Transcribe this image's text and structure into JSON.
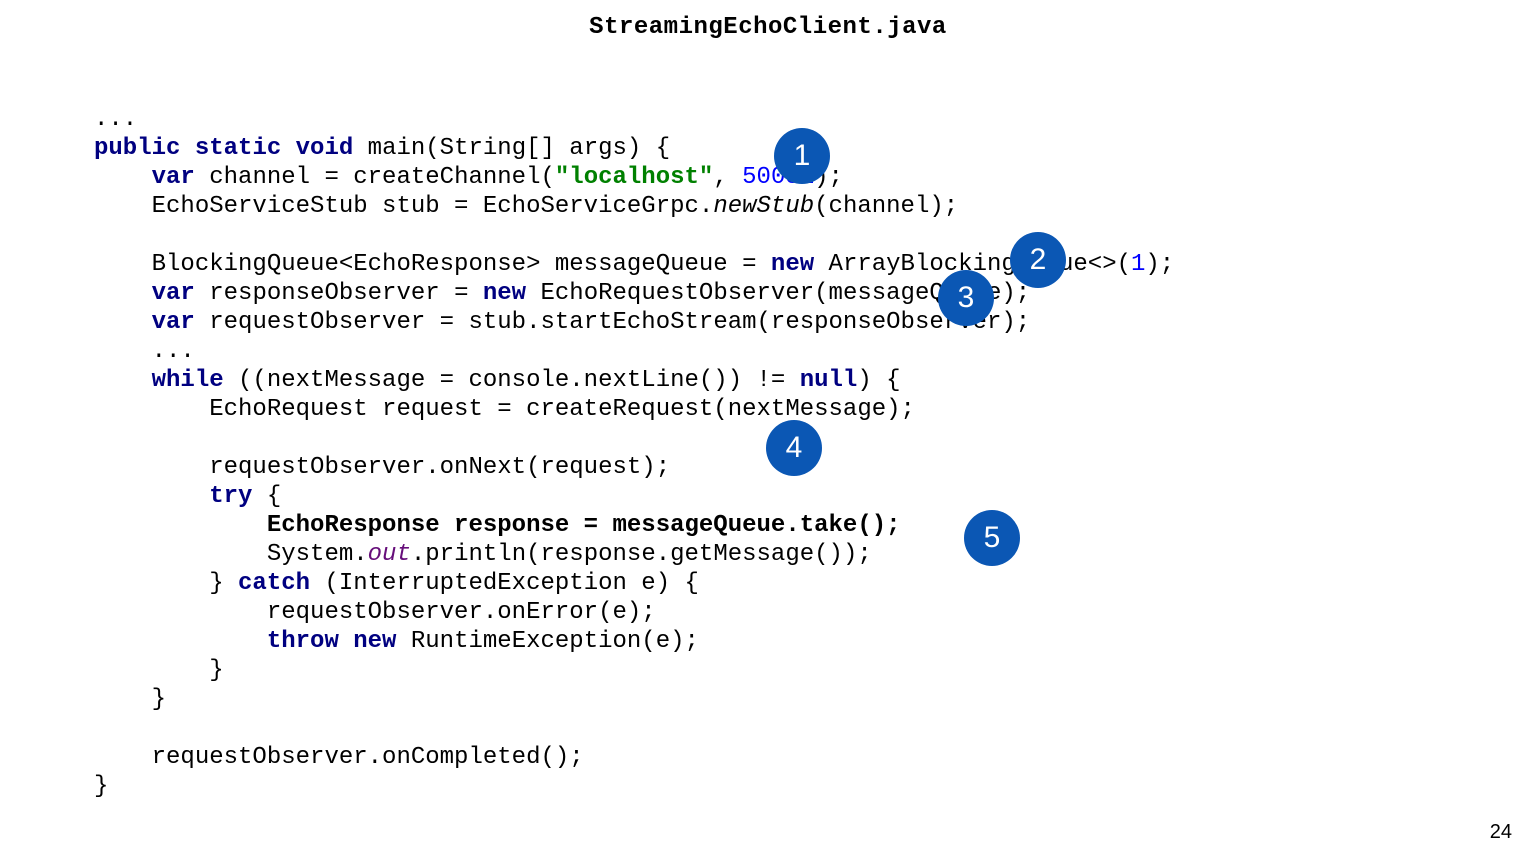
{
  "title": "StreamingEchoClient.java",
  "pageNumber": "24",
  "markers": {
    "m1": "1",
    "m2": "2",
    "m3": "3",
    "m4": "4",
    "m5": "5"
  },
  "code": {
    "l1": "...",
    "l2a": "public",
    "l2b": "static",
    "l2c": "void",
    "l2d": " main(String[] args) {",
    "l3a": "var",
    "l3b": " channel = createChannel(",
    "l3c": "\"localhost\"",
    "l3d": ", ",
    "l3e": "50051",
    "l3f": ");",
    "l4a": "    EchoServiceStub stub = EchoServiceGrpc.",
    "l4b": "newStub",
    "l4c": "(channel);",
    "l5": "",
    "l6a": "    BlockingQueue<EchoResponse> messageQueue = ",
    "l6b": "new",
    "l6c": " ArrayBlockingQueue<>(",
    "l6d": "1",
    "l6e": ");",
    "l7a": "var",
    "l7b": " responseObserver = ",
    "l7c": "new",
    "l7d": " EchoRequestObserver(messageQueue);",
    "l8a": "var",
    "l8b": " requestObserver = stub.startEchoStream(responseObserver);",
    "l9": "    ...",
    "l10a": "while",
    "l10b": " ((nextMessage = console.nextLine()) != ",
    "l10c": "null",
    "l10d": ") {",
    "l11": "        EchoRequest request = createRequest(nextMessage);",
    "l12": "",
    "l13": "        requestObserver.onNext(request);",
    "l14a": "try",
    "l14b": " {",
    "l15": "EchoResponse response = messageQueue.take();",
    "l16a": "            System.",
    "l16b": "out",
    "l16c": ".println(response.getMessage());",
    "l17a": "        } ",
    "l17b": "catch",
    "l17c": " (InterruptedException e) {",
    "l18": "            requestObserver.onError(e);",
    "l19a": "throw",
    "l19b": "new",
    "l19c": " RuntimeException(e);",
    "l20": "        }",
    "l21": "    }",
    "l22": "",
    "l23": "    requestObserver.onCompleted();",
    "l24": "}"
  }
}
